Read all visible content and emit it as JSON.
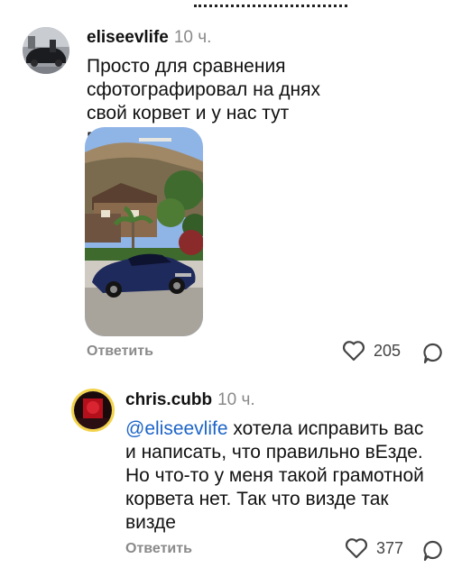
{
  "comments": [
    {
      "username": "eliseevlife",
      "time": "10 ч.",
      "text": "Просто для сравнения сфотографировал на днях свой корвет и у нас тут визде так",
      "reply_label": "Ответить",
      "likes": "205"
    },
    {
      "username": "chris.cubb",
      "time": "10 ч.",
      "mention": "@eliseevlife",
      "text": " хотела исправить вас и написать, что правильно вЕзде. Но что-то у меня такой грамотной корвета нет. Так что визде так визде",
      "reply_label": "Ответить",
      "likes": "377"
    }
  ],
  "icons": {
    "like": "heart-icon",
    "reply": "speech-bubble-icon"
  }
}
